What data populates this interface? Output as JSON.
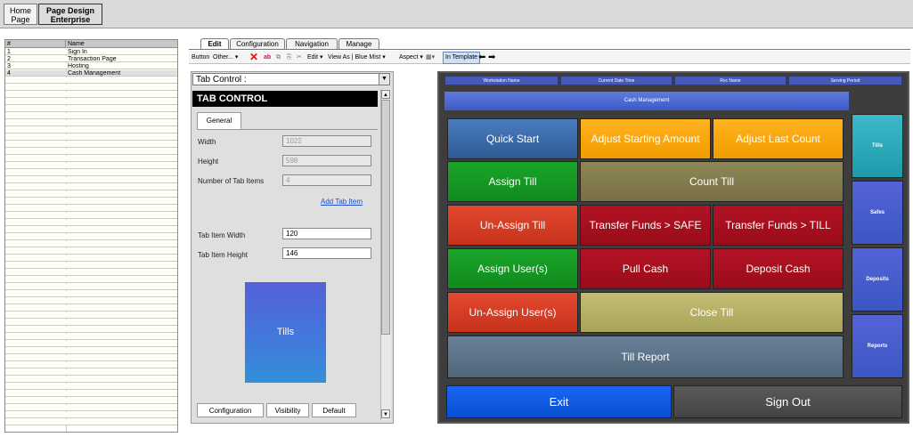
{
  "top_tabs": [
    {
      "line1": "Home",
      "line2": "Page"
    },
    {
      "line1": "Page Design",
      "line2": "Enterprise"
    }
  ],
  "page_list": {
    "headers": [
      "#",
      "Name"
    ],
    "rows": [
      {
        "num": "1",
        "name": "Sign In"
      },
      {
        "num": "2",
        "name": "Transaction Page"
      },
      {
        "num": "3",
        "name": "Hosting"
      },
      {
        "num": "4",
        "name": "Cash Management"
      }
    ]
  },
  "designer_tabs": [
    "Edit",
    "Configuration",
    "Navigation",
    "Manage"
  ],
  "toolbar": {
    "button": "Button",
    "other": "Other...",
    "edit": "Edit",
    "view_as": "View As | Blue Mist",
    "aspect": "Aspect",
    "in_template": "In Template"
  },
  "properties": {
    "combo": "Tab Control :",
    "section_title": "TAB CONTROL",
    "general_tab": "General",
    "width_label": "Width",
    "width_value": "1022",
    "height_label": "Height",
    "height_value": "598",
    "num_items_label": "Number of Tab Items",
    "num_items_value": "4",
    "add_link": "Add Tab Item",
    "item_width_label": "Tab Item Width",
    "item_width_value": "120",
    "item_height_label": "Tab Item Height",
    "item_height_value": "146",
    "preview_label": "Tills",
    "bottom_tabs": [
      "Configuration",
      "Visibility",
      "Default"
    ]
  },
  "pos": {
    "header": [
      "Workstation Name",
      "Current Date Time",
      "Rvc Name",
      "Serving Period"
    ],
    "title": "Cash Management",
    "buttons": {
      "quick_start": "Quick Start",
      "adjust_starting": "Adjust Starting Amount",
      "adjust_last": "Adjust Last Count",
      "assign_till": "Assign Till",
      "count_till": "Count Till",
      "unassign_till": "Un-Assign Till",
      "transfer_safe": "Transfer Funds > SAFE",
      "transfer_till": "Transfer Funds > TILL",
      "assign_user": "Assign User(s)",
      "pull_cash": "Pull Cash",
      "deposit_cash": "Deposit Cash",
      "unassign_user": "Un-Assign User(s)",
      "close_till": "Close Till",
      "till_report": "Till Report",
      "exit": "Exit",
      "sign_out": "Sign Out"
    },
    "side_tabs": [
      "Tills",
      "Safes",
      "Deposits",
      "Reports"
    ]
  },
  "colors": {
    "pos_blue": "#2e5a94",
    "pos_orange": "#f29c00",
    "pos_green": "#118a1d",
    "pos_red": "#c7321c",
    "pos_darkred": "#9a0c1a",
    "pos_exit": "#0a4fd2",
    "link": "#1f4fd1"
  }
}
